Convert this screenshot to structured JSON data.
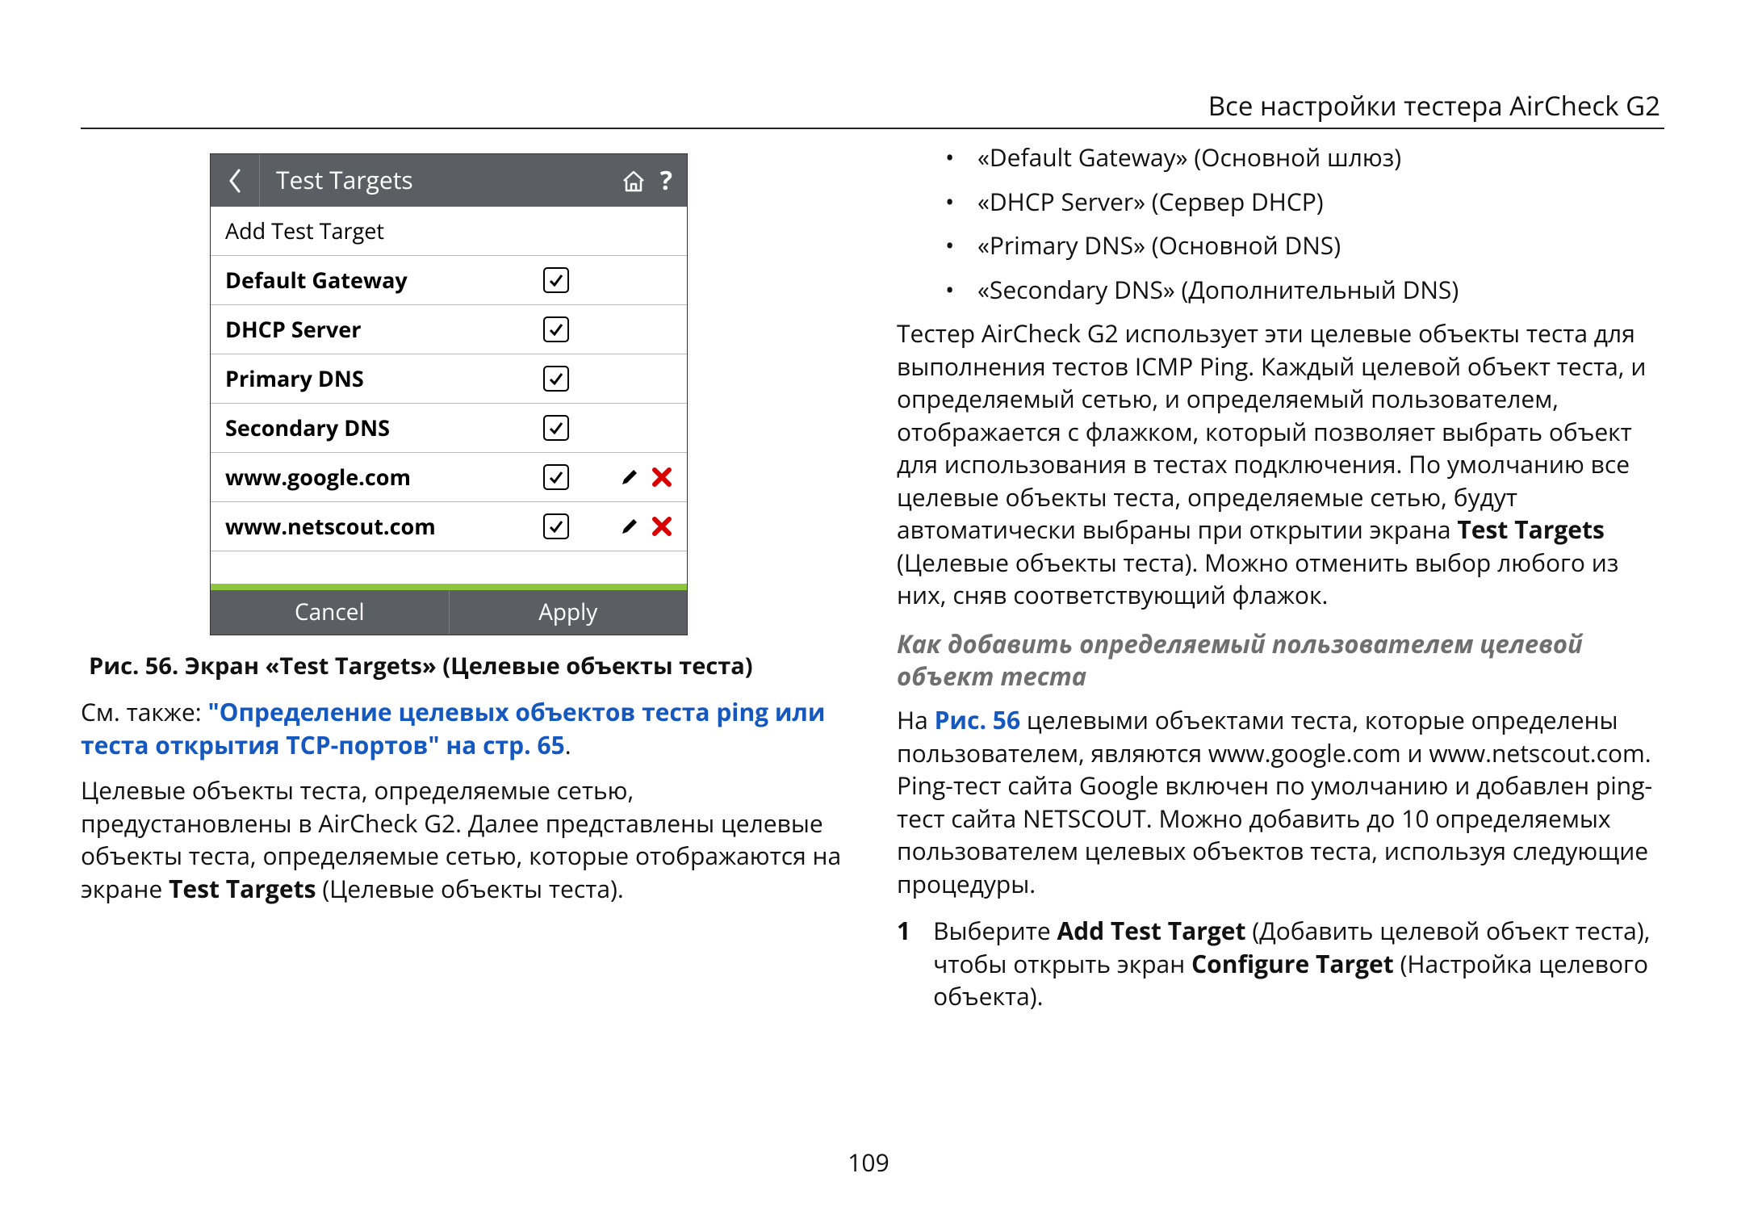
{
  "header": "Все настройки тестера AirCheck G2",
  "page_number": "109",
  "device": {
    "title": "Test Targets",
    "add_row": "Add Test Target",
    "rows": [
      {
        "label": "Default Gateway"
      },
      {
        "label": "DHCP Server"
      },
      {
        "label": "Primary DNS"
      },
      {
        "label": "Secondary DNS"
      },
      {
        "label": "www.google.com",
        "editable": true
      },
      {
        "label": "www.netscout.com",
        "editable": true
      }
    ],
    "cancel": "Cancel",
    "apply": "Apply"
  },
  "caption": "Рис. 56. Экран «Test Targets» (Целевые объекты теста)",
  "see_also_prefix": "См. также: ",
  "see_also_link": "\"Определение целевых объектов теста ping или теста открытия TCP-портов\" на стр. 65",
  "see_also_suffix": ".",
  "left_para": "Целевые объекты теста, определяемые сетью, предустановлены в AirCheck G2. Далее представлены целевые объекты теста, определяемые сетью, которые отображаются на экране ",
  "left_para_bold": "Test Targets",
  "left_para_tail": " (Целевые объекты теста).",
  "bullets": [
    "«Default Gateway» (Основной шлюз)",
    "«DHCP Server» (Сервер DHCP)",
    "«Primary DNS» (Основной DNS)",
    "«Secondary DNS» (Дополнительный DNS)"
  ],
  "right_para1_a": "Тестер AirCheck G2 использует эти целевые объекты теста для выполнения тестов ICMP Ping. Каждый целевой объект теста, и определяемый сетью, и определяемый пользователем, отображается с флажком, который позволяет выбрать объект для использования в тестах подключения. По умолчанию все целевые объекты теста, определяемые сетью, будут автоматически выбраны при открытии экрана ",
  "right_para1_bold": "Test Targets",
  "right_para1_b": " (Целевые объекты теста). Можно отменить выбор любого из них, сняв соответствующий флажок.",
  "subhead": "Как добавить определяемый пользователем целевой объект теста",
  "right_para2_a": "На ",
  "right_para2_link": "Рис. 56",
  "right_para2_b": " целевыми объектами теста, которые определены пользователем, являются www.google.com и www.netscout.com. Ping-тест сайта Google включен по умолчанию и добавлен ping-тест сайта NETSCOUT. Можно добавить до 10 определяемых пользователем целевых объектов теста, используя следующие процедуры.",
  "step_num": "1",
  "step_a": "Выберите ",
  "step_bold1": "Add Test Target",
  "step_b": " (Добавить целевой объект теста), чтобы открыть экран ",
  "step_bold2": "Configure Target",
  "step_c": " (Настройка целевого объекта)."
}
